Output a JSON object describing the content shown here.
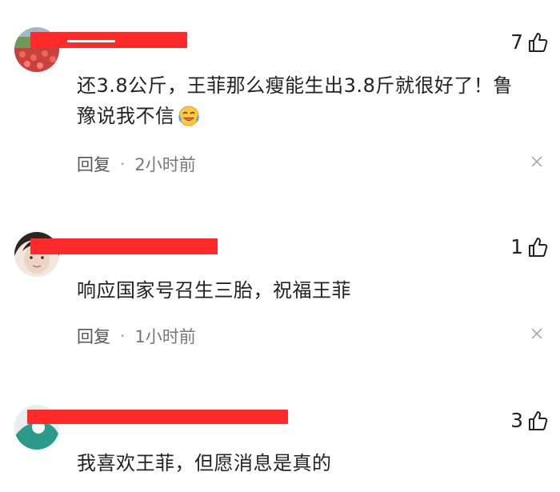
{
  "comments": [
    {
      "username": "“”——",
      "likes": "7",
      "text_line1": "还3.8公斤，王菲那么瘦能生出3.8斤就很好了！鲁",
      "text_line2": "豫说我不信",
      "emoji": "crying-laughing-emoji",
      "reply_label": "回复",
      "dot": "·",
      "time": "2小时前",
      "avatar_colors": [
        "#c8413c",
        "#7fa05a",
        "#e86a5a"
      ]
    },
    {
      "username": "",
      "likes": "1",
      "text_line1": "响应国家号召生三胎，祝福王菲",
      "reply_label": "回复",
      "dot": "·",
      "time": "1小时前",
      "avatar_colors": [
        "#3a2e2a",
        "#e9d9cf"
      ]
    },
    {
      "username": "",
      "likes": "3",
      "text_line1": "我喜欢王菲，但愿消息是真的",
      "avatar_colors": [
        "#2a9a8a",
        "#e8f0f2"
      ]
    }
  ],
  "icons": {
    "like": "thumbs-up-icon",
    "close": "close-icon"
  },
  "colors": {
    "redaction": "#ff2a2a",
    "meta": "#777777",
    "text": "#222222"
  }
}
